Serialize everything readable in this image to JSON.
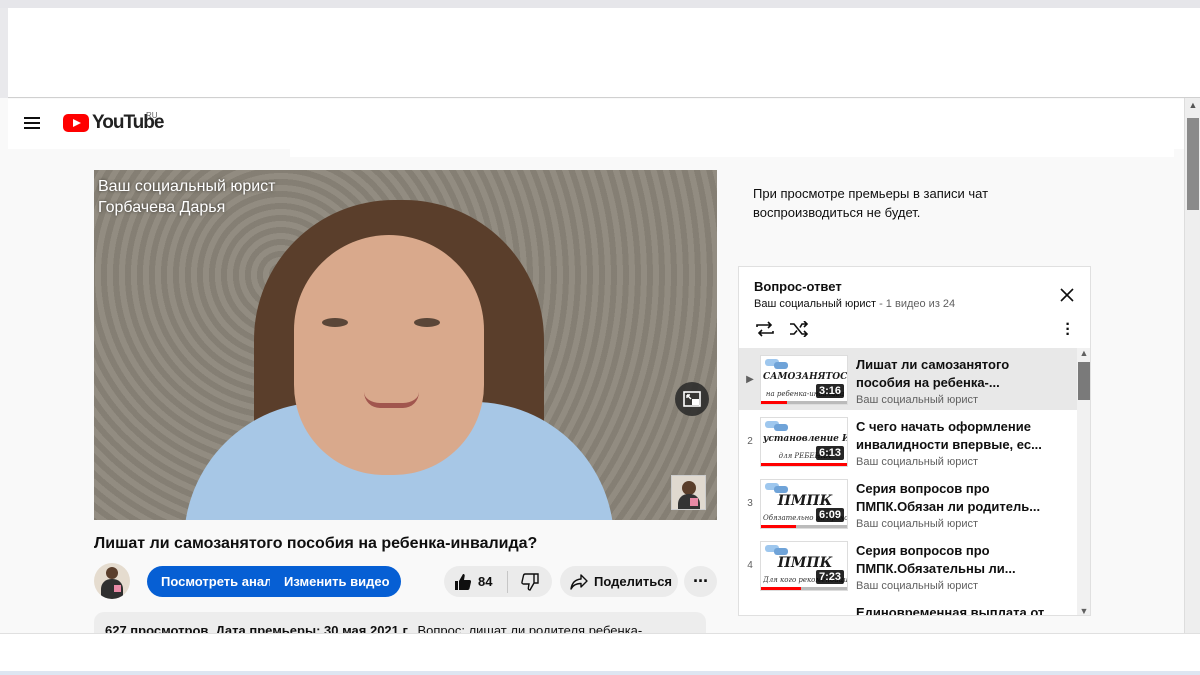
{
  "masthead": {
    "logo_text": "YouTube",
    "region": "RU"
  },
  "player": {
    "overlay_line1": "Ваш социальный юрист",
    "overlay_line2": "Горбачева Дарья"
  },
  "video": {
    "title": "Лишат ли самозанятого пособия на ребенка-инвалида?",
    "analytics_label": "Посмотреть аналитику",
    "edit_label": "Изменить видео",
    "likes": "84",
    "share_label": "Поделиться",
    "more_label": "···"
  },
  "description": {
    "views": "627 просмотров",
    "premiere": "Дата премьеры: 30 мая 2021 г.",
    "text": "Вопрос: лишат ли родителя ребенка-"
  },
  "chat_note": "При просмотре премьеры в записи чат воспроизводиться не будет.",
  "playlist": {
    "title": "Вопрос-ответ",
    "channel": "Ваш социальный юрист",
    "position": " - 1 видео из 24",
    "items": [
      {
        "index": "▶",
        "thumb_top": "САМОЗАНЯТОСТЬ И ПОСОБИЯ",
        "thumb_bottom": "на ребенка-инвалида",
        "duration": "3:16",
        "progress": 0.3,
        "title": "Лишат ли самозанятого пособия на ребенка-...",
        "channel": "Ваш социальный юрист"
      },
      {
        "index": "2",
        "thumb_top": "установление ИНВАЛИДНОСТИ",
        "thumb_bottom": "для РЕБЕНКА",
        "duration": "6:13",
        "progress": 1.0,
        "title": "С чего начать оформление инвалидности впервые, ес...",
        "channel": "Ваш социальный юрист"
      },
      {
        "index": "3",
        "thumb_top": "ПМПК",
        "thumb_bottom": "Обязательно ли проходить",
        "duration": "6:09",
        "progress": 0.4,
        "title": "Серия вопросов про ПМПК.Обязан ли родитель...",
        "channel": "Ваш социальный юрист"
      },
      {
        "index": "4",
        "thumb_top": "ПМПК",
        "thumb_bottom": "Для кого рекомендации обязательны",
        "duration": "7:23",
        "progress": 0.45,
        "title": "Серия вопросов про ПМПК.Обязательны ли...",
        "channel": "Ваш социальный юрист"
      },
      {
        "index": "",
        "thumb_top": "",
        "thumb_bottom": "",
        "duration": "",
        "progress": 0,
        "title": "Единовременная выплата от",
        "channel": ""
      }
    ]
  },
  "colors": {
    "brand_red": "#ff0000",
    "studio_blue": "#065fd4",
    "chip_bg": "#ebebeb"
  }
}
